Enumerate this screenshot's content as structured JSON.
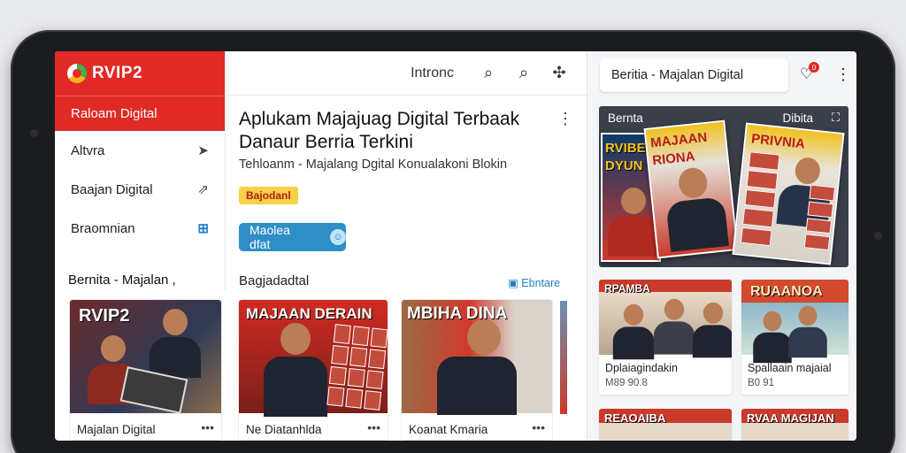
{
  "sidebar": {
    "logo": "RVIP2",
    "active_item": "Raloam Digital",
    "items": [
      {
        "label": "Altvra",
        "icon": "send-icon"
      },
      {
        "label": "Baajan Digital",
        "icon": "share-icon"
      },
      {
        "label": "Braomnian",
        "icon": "grid-icon"
      }
    ],
    "section": "Bernita - Majalan ,"
  },
  "topbar": {
    "label": "Intronc"
  },
  "main": {
    "title": "Aplukam Majajuag Digital Terbaak Danaur Berria Terkini",
    "subtitle": "Tehloanm - Majalang Dgital Konualakoni Blokin",
    "badge": "Bajodanl",
    "cta_label": "Maolea dfat",
    "section_label": "Bagjadadtal",
    "section_link": "Ebntare",
    "cards": [
      {
        "caption": "Majalan Digital",
        "cover": "RVIP2"
      },
      {
        "caption": "Ne Diatanhlda",
        "cover": "MAJAAN DERAIN"
      },
      {
        "caption": "Koanat Kmaria",
        "cover": "MBIHA DINA"
      }
    ]
  },
  "right_panel": {
    "search_text": "Beritia - Majalan Digital",
    "notif_count": "0",
    "hero_label": "Bernta",
    "hero_label2": "Dibita",
    "hero_covers": [
      "RVIBE DYUN",
      "MAJAAN RIONA",
      "PRIVNIA"
    ],
    "cards": [
      {
        "title": "Dplaiagindakin",
        "meta": "M89 90.8",
        "cover": "RPAMBA"
      },
      {
        "title": "Spallaain majaial",
        "meta": "B0 91",
        "cover": "RUAANOA"
      },
      {
        "cover": "REAOAIBA"
      },
      {
        "cover": "RVAA MAGIJAN"
      }
    ]
  },
  "colors": {
    "brand_red": "#e02a26",
    "accent_blue": "#2f8ec6",
    "badge_yellow": "#f7d046"
  }
}
